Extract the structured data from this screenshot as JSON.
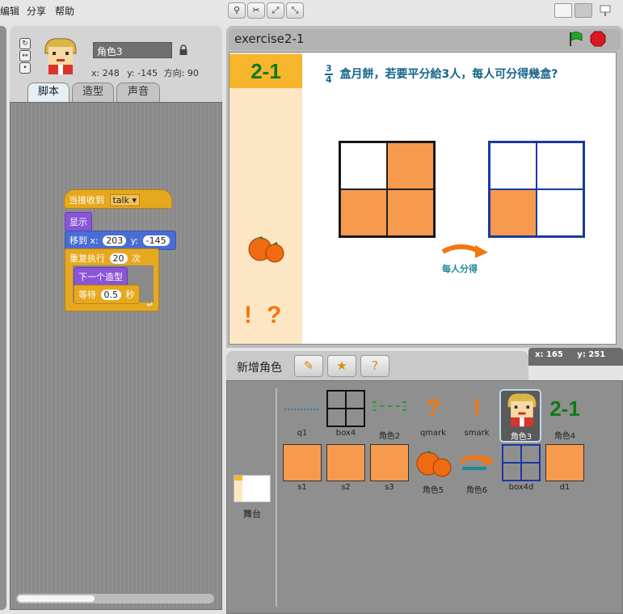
{
  "menu": {
    "items": [
      "编辑",
      "分享",
      "帮助"
    ]
  },
  "toolbar": {
    "tool_icons": [
      "stamp-icon",
      "scissors-icon",
      "grow-icon",
      "shrink-icon"
    ]
  },
  "sprite": {
    "name": "角色3",
    "x_label": "x:",
    "x": "248",
    "y_label": "y:",
    "y": "-145",
    "direction_label": "方向:",
    "direction": "90"
  },
  "tabs": [
    "脚本",
    "造型",
    "声音"
  ],
  "script": {
    "when_receive": "当接收到",
    "message": "talk",
    "show": "显示",
    "goto": "移到 x:",
    "goto_x": "203",
    "goto_y_label": "y:",
    "goto_y": "-145",
    "repeat": "重复执行",
    "repeat_count": "20",
    "repeat_unit": "次",
    "next_costume": "下一个造型",
    "wait": "等待",
    "wait_value": "0.5",
    "wait_unit": "秒"
  },
  "stage": {
    "title": "exercise2-1",
    "badge": "2-1",
    "question_num": "3",
    "question_den": "4",
    "question_text": "盒月餅，若要平分給3人，每人可分得幾盒?",
    "arrow_label": "每人分得",
    "exclaim": "!",
    "qmark": "?",
    "colors": {
      "fill": "#f79a4e",
      "badge": "#f7b52c",
      "side": "#fde6c4"
    }
  },
  "mouse": {
    "x_label": "x:",
    "x": "165",
    "y_label": "y:",
    "y": "251"
  },
  "library": {
    "new_sprite_label": "新增角色",
    "stage_label": "舞台",
    "sprites": [
      {
        "label": "q1"
      },
      {
        "label": "box4"
      },
      {
        "label": "角色2"
      },
      {
        "label": "qmark"
      },
      {
        "label": "smark"
      },
      {
        "label": "角色3"
      },
      {
        "label": "角色4"
      },
      {
        "label": "s1"
      },
      {
        "label": "s2"
      },
      {
        "label": "s3"
      },
      {
        "label": "角色5"
      },
      {
        "label": "角色6"
      },
      {
        "label": "box4d"
      },
      {
        "label": "d1"
      }
    ],
    "sprite4_text": "2-1",
    "smark_text": "!",
    "qmark_text": "?"
  }
}
